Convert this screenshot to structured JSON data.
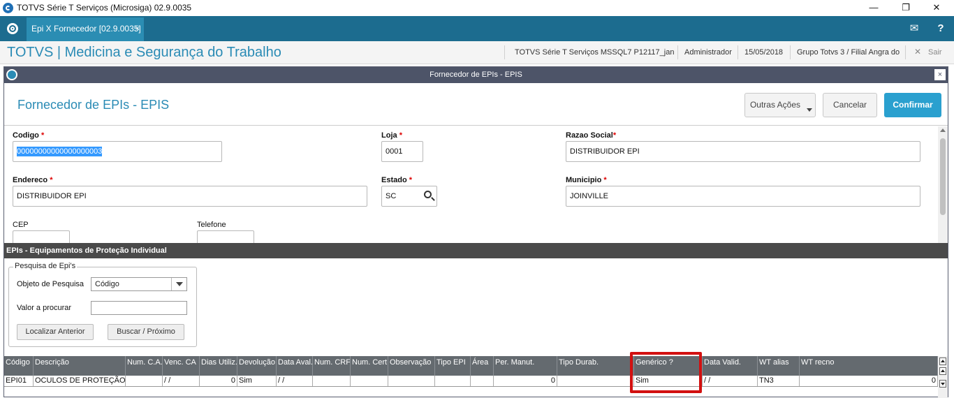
{
  "window": {
    "title": "TOTVS Série T Serviços (Microsiga) 02.9.0035",
    "controls": {
      "minimize": "—",
      "restore": "❐",
      "close": "✕"
    }
  },
  "topbar": {
    "tab_label": "Epi X Fornecedor [02.9.0035]",
    "tab_close": "×",
    "mail_icon": "✉",
    "help_icon": "?"
  },
  "module": {
    "title": "TOTVS | Medicina e Segurança do Trabalho",
    "environment": "TOTVS Série T Serviços MSSQL7 P12117_jan",
    "user": "Administrador",
    "date": "15/05/2018",
    "branch": "Grupo Totvs 3 / Filial Angra do",
    "exit_label": "Sair",
    "exit_icon": "✕"
  },
  "dialog": {
    "title": "Fornecedor de EPIs - EPIS",
    "close": "×",
    "form_title": "Fornecedor de EPIs - EPIS",
    "buttons": {
      "other": "Outras Ações",
      "cancel": "Cancelar",
      "confirm": "Confirmar"
    }
  },
  "fields": {
    "codigo": {
      "label": "Codigo",
      "req": "*",
      "value": "00000000000000000003"
    },
    "loja": {
      "label": "Loja",
      "req": "*",
      "value": "0001"
    },
    "razao": {
      "label": "Razao Social",
      "req": "*",
      "value": "DISTRIBUIDOR EPI"
    },
    "endereco": {
      "label": "Endereco",
      "req": "*",
      "value": "DISTRIBUIDOR EPI"
    },
    "estado": {
      "label": "Estado",
      "req": "*",
      "value": "SC"
    },
    "municipio": {
      "label": "Municipio",
      "req": "*",
      "value": "JOINVILLE"
    },
    "cep": {
      "label": "CEP",
      "value": "-"
    },
    "telefone": {
      "label": "Telefone",
      "value": "-"
    }
  },
  "section": {
    "title": "EPIs  -  Equipamentos de Proteção Individual"
  },
  "search": {
    "legend": "Pesquisa de Epi's",
    "object_label": "Objeto de Pesquisa",
    "object_value": "Código",
    "value_label": "Valor a procurar",
    "value_input": "",
    "prev_button": "Localizar Anterior",
    "next_button": "Buscar / Próximo"
  },
  "grid": {
    "headers": [
      "Código",
      "Descrição",
      "Num. C.A.",
      "Venc. CA",
      "Dias Utiliz.",
      "Devolução",
      "Data Aval.",
      "Num. CRF",
      "Num. Cert.",
      "Observação",
      "Tipo EPI",
      "Área",
      "Per. Manut.",
      "Tipo Durab.",
      "Genérico ?",
      "Data Valid.",
      "WT alias",
      "WT recno"
    ],
    "rows": [
      [
        "EPI01",
        "OCULOS DE PROTEÇÃO",
        "",
        " / /",
        "0",
        "Sim",
        " / /",
        "",
        "",
        "",
        "",
        "",
        "0",
        "",
        "Sim",
        " / /",
        "TN3",
        "0"
      ]
    ]
  }
}
